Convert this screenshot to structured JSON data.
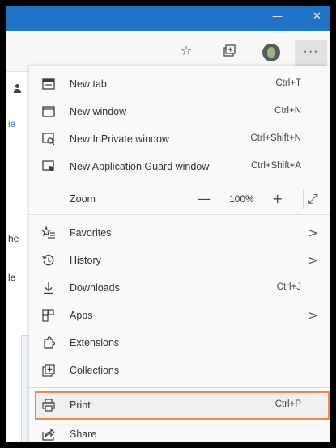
{
  "window": {
    "minimize_glyph": "—",
    "close_glyph": "✕"
  },
  "toolbar": {
    "favorite_icon": "star-icon",
    "collections_icon": "collections-icon",
    "more_label": "···"
  },
  "page": {
    "fragments": [
      "ie",
      "he",
      "le"
    ]
  },
  "menu": {
    "items": [
      {
        "label": "New tab",
        "shortcut": "Ctrl+T",
        "icon": "new-tab-icon"
      },
      {
        "label": "New window",
        "shortcut": "Ctrl+N",
        "icon": "new-window-icon"
      },
      {
        "label": "New InPrivate window",
        "shortcut": "Ctrl+Shift+N",
        "icon": "inprivate-icon"
      },
      {
        "label": "New Application Guard window",
        "shortcut": "Ctrl+Shift+A",
        "icon": "application-guard-icon"
      }
    ],
    "zoom": {
      "label": "Zoom",
      "minus": "—",
      "value": "100%",
      "plus": "+",
      "fullscreen": "⤢"
    },
    "items2": [
      {
        "label": "Favorites",
        "shortcut": "",
        "arrow": ">",
        "icon": "favorites-icon"
      },
      {
        "label": "History",
        "shortcut": "",
        "arrow": ">",
        "icon": "history-icon"
      },
      {
        "label": "Downloads",
        "shortcut": "Ctrl+J",
        "arrow": "",
        "icon": "download-icon"
      },
      {
        "label": "Apps",
        "shortcut": "",
        "arrow": ">",
        "icon": "apps-icon"
      },
      {
        "label": "Extensions",
        "shortcut": "",
        "arrow": "",
        "icon": "extensions-icon"
      },
      {
        "label": "Collections",
        "shortcut": "",
        "arrow": "",
        "icon": "collections-icon"
      }
    ],
    "print": {
      "label": "Print",
      "shortcut": "Ctrl+P",
      "icon": "print-icon"
    },
    "share": {
      "label": "Share",
      "icon": "share-icon"
    }
  },
  "colors": {
    "titlebar": "#1f72c4",
    "highlight_border": "#e98a4e"
  }
}
